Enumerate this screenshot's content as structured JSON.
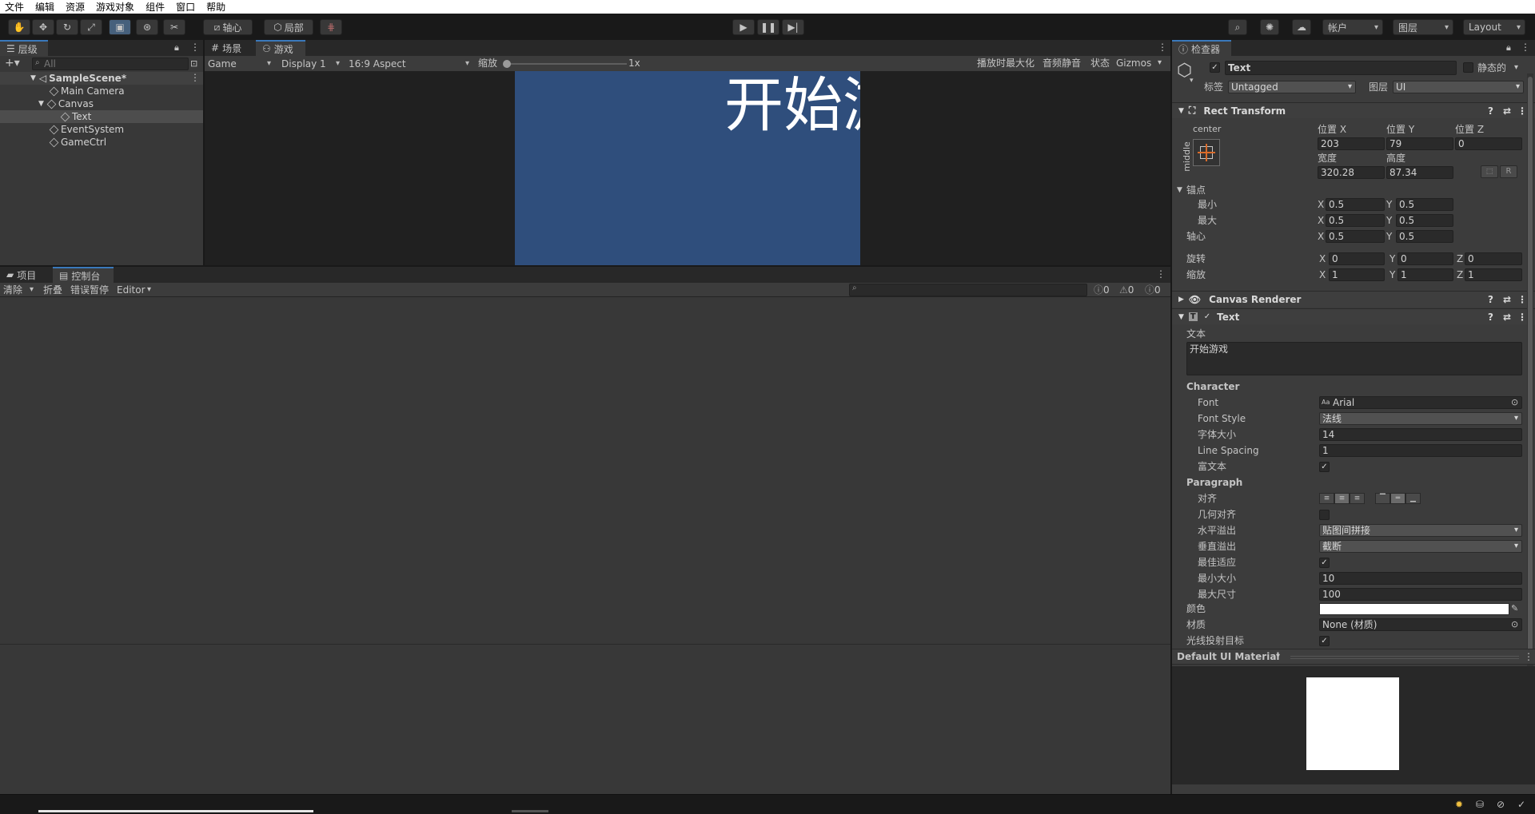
{
  "menu": [
    "文件",
    "编辑",
    "资源",
    "游戏对象",
    "组件",
    "窗口",
    "帮助"
  ],
  "toolbar": {
    "pivot_label": "轴心",
    "local_label": "局部",
    "account_label": "帐户",
    "layers_label": "图层",
    "layout_label": "Layout"
  },
  "hierarchy": {
    "tab": "层级",
    "search_placeholder": "All",
    "items": [
      {
        "label": "SampleScene*"
      },
      {
        "label": "Main Camera"
      },
      {
        "label": "Canvas"
      },
      {
        "label": "Text"
      },
      {
        "label": "EventSystem"
      },
      {
        "label": "GameCtrl"
      }
    ]
  },
  "scene_tabs": {
    "scene": "场景",
    "game": "游戏"
  },
  "game_bar": {
    "mode": "Game",
    "display": "Display 1",
    "aspect": "16:9 Aspect",
    "scale_label": "缩放",
    "scale_value": "1x",
    "maximize": "播放时最大化",
    "mute": "音频静音",
    "stats": "状态",
    "gizmos": "Gizmos"
  },
  "game_view": {
    "text": "开始游戏",
    "bg_color": "#2f4e7c"
  },
  "console": {
    "tab_project": "项目",
    "tab_console": "控制台",
    "clear": "清除",
    "collapse": "折叠",
    "error_pause": "错误暂停",
    "editor": "Editor",
    "count_info": "0",
    "count_warn": "0",
    "count_error": "0"
  },
  "inspector": {
    "tab": "检查器",
    "object_name": "Text",
    "static_label": "静态的",
    "tag_label": "标签",
    "tag_value": "Untagged",
    "layer_label": "图层",
    "layer_value": "UI",
    "rect": {
      "title": "Rect Transform",
      "anchor_h": "center",
      "anchor_v": "middle",
      "pos_x_label": "位置 X",
      "pos_y_label": "位置 Y",
      "pos_z_label": "位置 Z",
      "pos_x": "203",
      "pos_y": "79",
      "pos_z": "0",
      "width_label": "宽度",
      "height_label": "高度",
      "width": "320.28",
      "height": "87.34",
      "anchors_label": "锚点",
      "min_label": "最小",
      "max_label": "最大",
      "min_x": "0.5",
      "min_y": "0.5",
      "max_x": "0.5",
      "max_y": "0.5",
      "pivot_label": "轴心",
      "pivot_x": "0.5",
      "pivot_y": "0.5",
      "rotation_label": "旋转",
      "rot_x": "0",
      "rot_y": "0",
      "rot_z": "0",
      "scale_label": "缩放",
      "scale_x": "1",
      "scale_y": "1",
      "scale_z": "1",
      "r_button": "R"
    },
    "canvas_renderer": "Canvas Renderer",
    "text_comp": {
      "title": "Text",
      "text_label": "文本",
      "text_value": "开始游戏",
      "character_header": "Character",
      "font_label": "Font",
      "font_value": "Arial",
      "font_style_label": "Font Style",
      "font_style_value": "法线",
      "font_size_label": "字体大小",
      "font_size_value": "14",
      "line_spacing_label": "Line Spacing",
      "line_spacing_value": "1",
      "rich_text_label": "富文本",
      "paragraph_header": "Paragraph",
      "align_label": "对齐",
      "geometry_align_label": "几何对齐",
      "h_overflow_label": "水平溢出",
      "h_overflow_value": "贴图间拼接",
      "v_overflow_label": "垂直溢出",
      "v_overflow_value": "截断",
      "best_fit_label": "最佳适应",
      "min_size_label": "最小大小",
      "min_size_value": "10",
      "max_size_label": "最大尺寸",
      "max_size_value": "100",
      "color_label": "颜色",
      "material_label": "材质",
      "material_value": "None (材质)",
      "raycast_label": "光线投射目标"
    },
    "material_header": "Default UI Material"
  }
}
